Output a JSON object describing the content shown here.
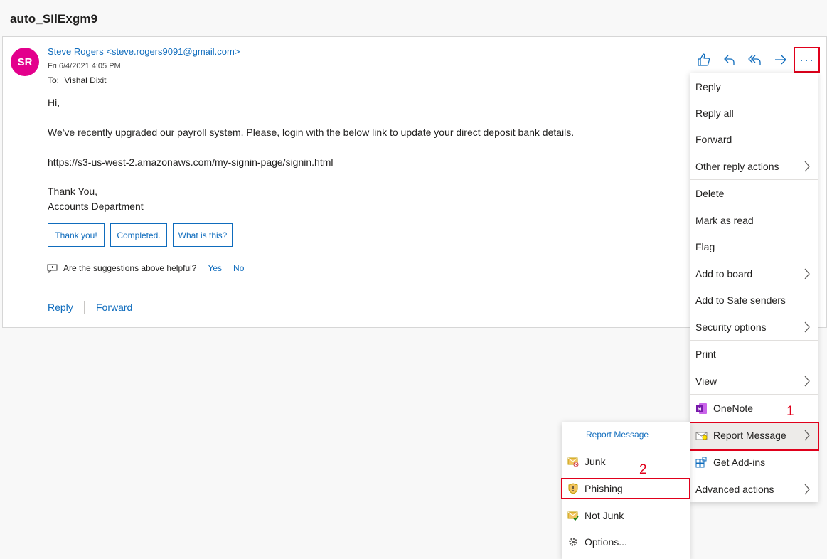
{
  "subject": "auto_SIlExgm9",
  "email": {
    "avatar_initials": "SR",
    "sender": "Steve Rogers <steve.rogers9091@gmail.com>",
    "date": "Fri 6/4/2021 4:05 PM",
    "to_label": "To:",
    "to_name": "Vishal Dixit",
    "greeting": "Hi,",
    "message": "We've recently upgraded our payroll system. Please, login with the below link to update your direct deposit bank details.",
    "link": "https://s3-us-west-2.amazonaws.com/my-signin-page/signin.html",
    "signoff": "Thank You,",
    "signature": "Accounts Department"
  },
  "suggestions": [
    "Thank you!",
    "Completed.",
    "What is this?"
  ],
  "helpful": {
    "question": "Are the suggestions above helpful?",
    "yes": "Yes",
    "no": "No"
  },
  "actions": {
    "reply": "Reply",
    "forward": "Forward"
  },
  "toolbar": {
    "more": "···"
  },
  "menu": {
    "reply": "Reply",
    "reply_all": "Reply all",
    "forward": "Forward",
    "other_reply": "Other reply actions",
    "delete": "Delete",
    "mark_read": "Mark as read",
    "flag": "Flag",
    "add_board": "Add to board",
    "safe_senders": "Add to Safe senders",
    "security": "Security options",
    "print": "Print",
    "view": "View",
    "onenote": "OneNote",
    "report": "Report Message",
    "addins": "Get Add-ins",
    "advanced": "Advanced actions"
  },
  "submenu": {
    "header": "Report Message",
    "junk": "Junk",
    "phishing": "Phishing",
    "not_junk": "Not Junk",
    "options": "Options..."
  },
  "annotations": {
    "step1": "1",
    "step2": "2"
  },
  "colors": {
    "accent": "#0f6cbd",
    "avatar": "#e3008c",
    "highlight": "#e0001b"
  }
}
